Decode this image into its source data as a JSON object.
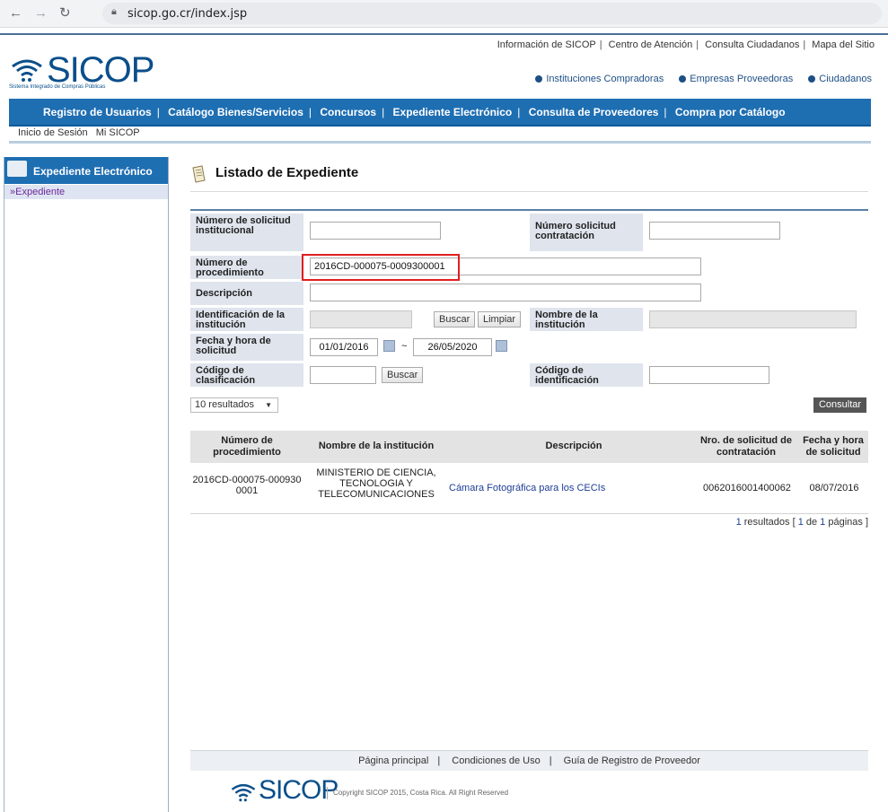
{
  "browser": {
    "back_icon": "arrow-left-icon",
    "forward_icon": "arrow-right-icon",
    "reload_icon": "reload-icon",
    "url": "sicop.go.cr/index.jsp"
  },
  "header": {
    "top_links": [
      "Información de SICOP",
      "Centro de Atención",
      "Consulta Ciudadanos",
      "Mapa del Sitio"
    ],
    "logo_text": "SICOP",
    "logo_tagline": "Sistema Integrado de Compras Públicas",
    "roles": [
      "Instituciones Compradoras",
      "Empresas Proveedoras",
      "Ciudadanos"
    ],
    "main_nav": [
      "Registro de Usuarios",
      "Catálogo Bienes/Servicios",
      "Concursos",
      "Expediente Electrónico",
      "Consulta de Proveedores",
      "Compra por Catálogo"
    ],
    "sub_nav": [
      "Inicio de Sesión",
      "Mi SICOP"
    ]
  },
  "sidebar": {
    "title": "Expediente Electrónico",
    "items": [
      {
        "label": "»Expediente"
      }
    ]
  },
  "page": {
    "title": "Listado de Expediente"
  },
  "form": {
    "num_solicitud_institucional_label": "Número de solicitud institucional",
    "num_solicitud_institucional_value": "",
    "num_solicitud_contratacion_label": "Número solicitud contratación",
    "num_solicitud_contratacion_value": "",
    "num_procedimiento_label": "Número de procedimiento",
    "num_procedimiento_value": "2016CD-000075-0009300001",
    "descripcion_label": "Descripción",
    "descripcion_value": "",
    "identificacion_label": "Identificación de la institución",
    "identificacion_value": "",
    "buscar_label": "Buscar",
    "limpiar_label": "Limpiar",
    "nombre_institucion_label": "Nombre de la institución",
    "nombre_institucion_value": "",
    "fecha_label": "Fecha y hora de solicitud",
    "fecha_desde": "01/01/2016",
    "fecha_sep": "~",
    "fecha_hasta": "26/05/2020",
    "codigo_clasificacion_label": "Código de clasificación",
    "codigo_clasificacion_value": "",
    "buscar2_label": "Buscar",
    "codigo_identificacion_label": "Código de identificación",
    "codigo_identificacion_value": ""
  },
  "results_select": {
    "value": "10 resultados",
    "arrow": "▼"
  },
  "consultar_label": "Consultar",
  "table": {
    "headers": [
      "Número de procedimiento",
      "Nombre de la institución",
      "Descripción",
      "Nro. de solicitud de contratación",
      "Fecha y hora de solicitud"
    ],
    "rows": [
      {
        "procedimiento": "2016CD-000075-0009300001",
        "institucion": "MINISTERIO DE CIENCIA, TECNOLOGIA Y TELECOMUNICACIONES",
        "descripcion": "Cámara Fotográfica para los CECIs",
        "nro_solicitud": "0062016001400062",
        "fecha": "08/07/2016"
      }
    ]
  },
  "paging": {
    "count": "1",
    "count_suffix": " resultados [ ",
    "page": "1",
    "of": " de ",
    "pages": "1",
    "pages_suffix": " páginas ]"
  },
  "footer": {
    "links": [
      "Página principal",
      "Condiciones de Uso",
      "Guía de Registro de Proveedor"
    ],
    "logo_text": "SICOP",
    "copyright": "Copyright SICOP 2015, Costa Rica. All Right Reserved"
  },
  "colors": {
    "nav_blue": "#1e6eb2",
    "logo_blue": "#0b4f8a",
    "highlight_red": "#e01e1e"
  }
}
